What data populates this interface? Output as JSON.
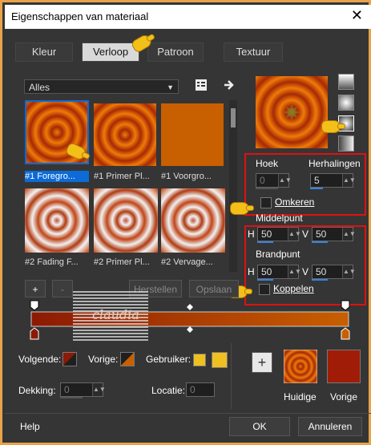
{
  "window": {
    "title": "Eigenschappen van materiaal",
    "close": "✕"
  },
  "tabs": [
    {
      "label": "Kleur",
      "selected": false
    },
    {
      "label": "Verloop",
      "selected": true
    },
    {
      "label": "Patroon",
      "selected": false
    },
    {
      "label": "Textuur",
      "selected": false
    }
  ],
  "library": {
    "filter": "Alles",
    "thumbnails": [
      {
        "caption": "#1 Foregro...",
        "selected": true
      },
      {
        "caption": "#1 Primer Pl...",
        "selected": false
      },
      {
        "caption": "#1 Voorgro...",
        "selected": false
      },
      {
        "caption": "#2 Fading F...",
        "selected": false
      },
      {
        "caption": "#2 Primer Pl...",
        "selected": false
      },
      {
        "caption": "#2 Vervage...",
        "selected": false
      }
    ]
  },
  "style": {
    "angle_label": "Hoek",
    "angle_value": "0",
    "repeats_label": "Herhalingen",
    "repeats_value": "5",
    "invert_label": "Omkeren",
    "center_label": "Middelpunt",
    "center_h": "50",
    "center_v": "50",
    "focal_label": "Brandpunt",
    "focal_h": "50",
    "focal_v": "50",
    "link_label": "Koppelen",
    "h_label": "H",
    "v_label": "V"
  },
  "editor": {
    "add": "+",
    "remove": "-",
    "reset": "Herstellen",
    "save": "Opslaan",
    "watermark": "claudia"
  },
  "stops": {
    "next_label": "Volgende:",
    "prev_label": "Vorige:",
    "user_label": "Gebruiker:",
    "opacity_label": "Dekking:",
    "opacity_value": "0",
    "location_label": "Locatie:",
    "location_value": "0"
  },
  "preview": {
    "add": "+",
    "current_label": "Huidige",
    "previous_label": "Vorige"
  },
  "footer": {
    "help": "Help",
    "ok": "OK",
    "cancel": "Annuleren"
  },
  "colors": {
    "orange": "#c85f00",
    "dark_red": "#8c1a04",
    "yellow": "#f0c020",
    "accent_red": "#e01010",
    "selection": "#0c6bd6"
  }
}
